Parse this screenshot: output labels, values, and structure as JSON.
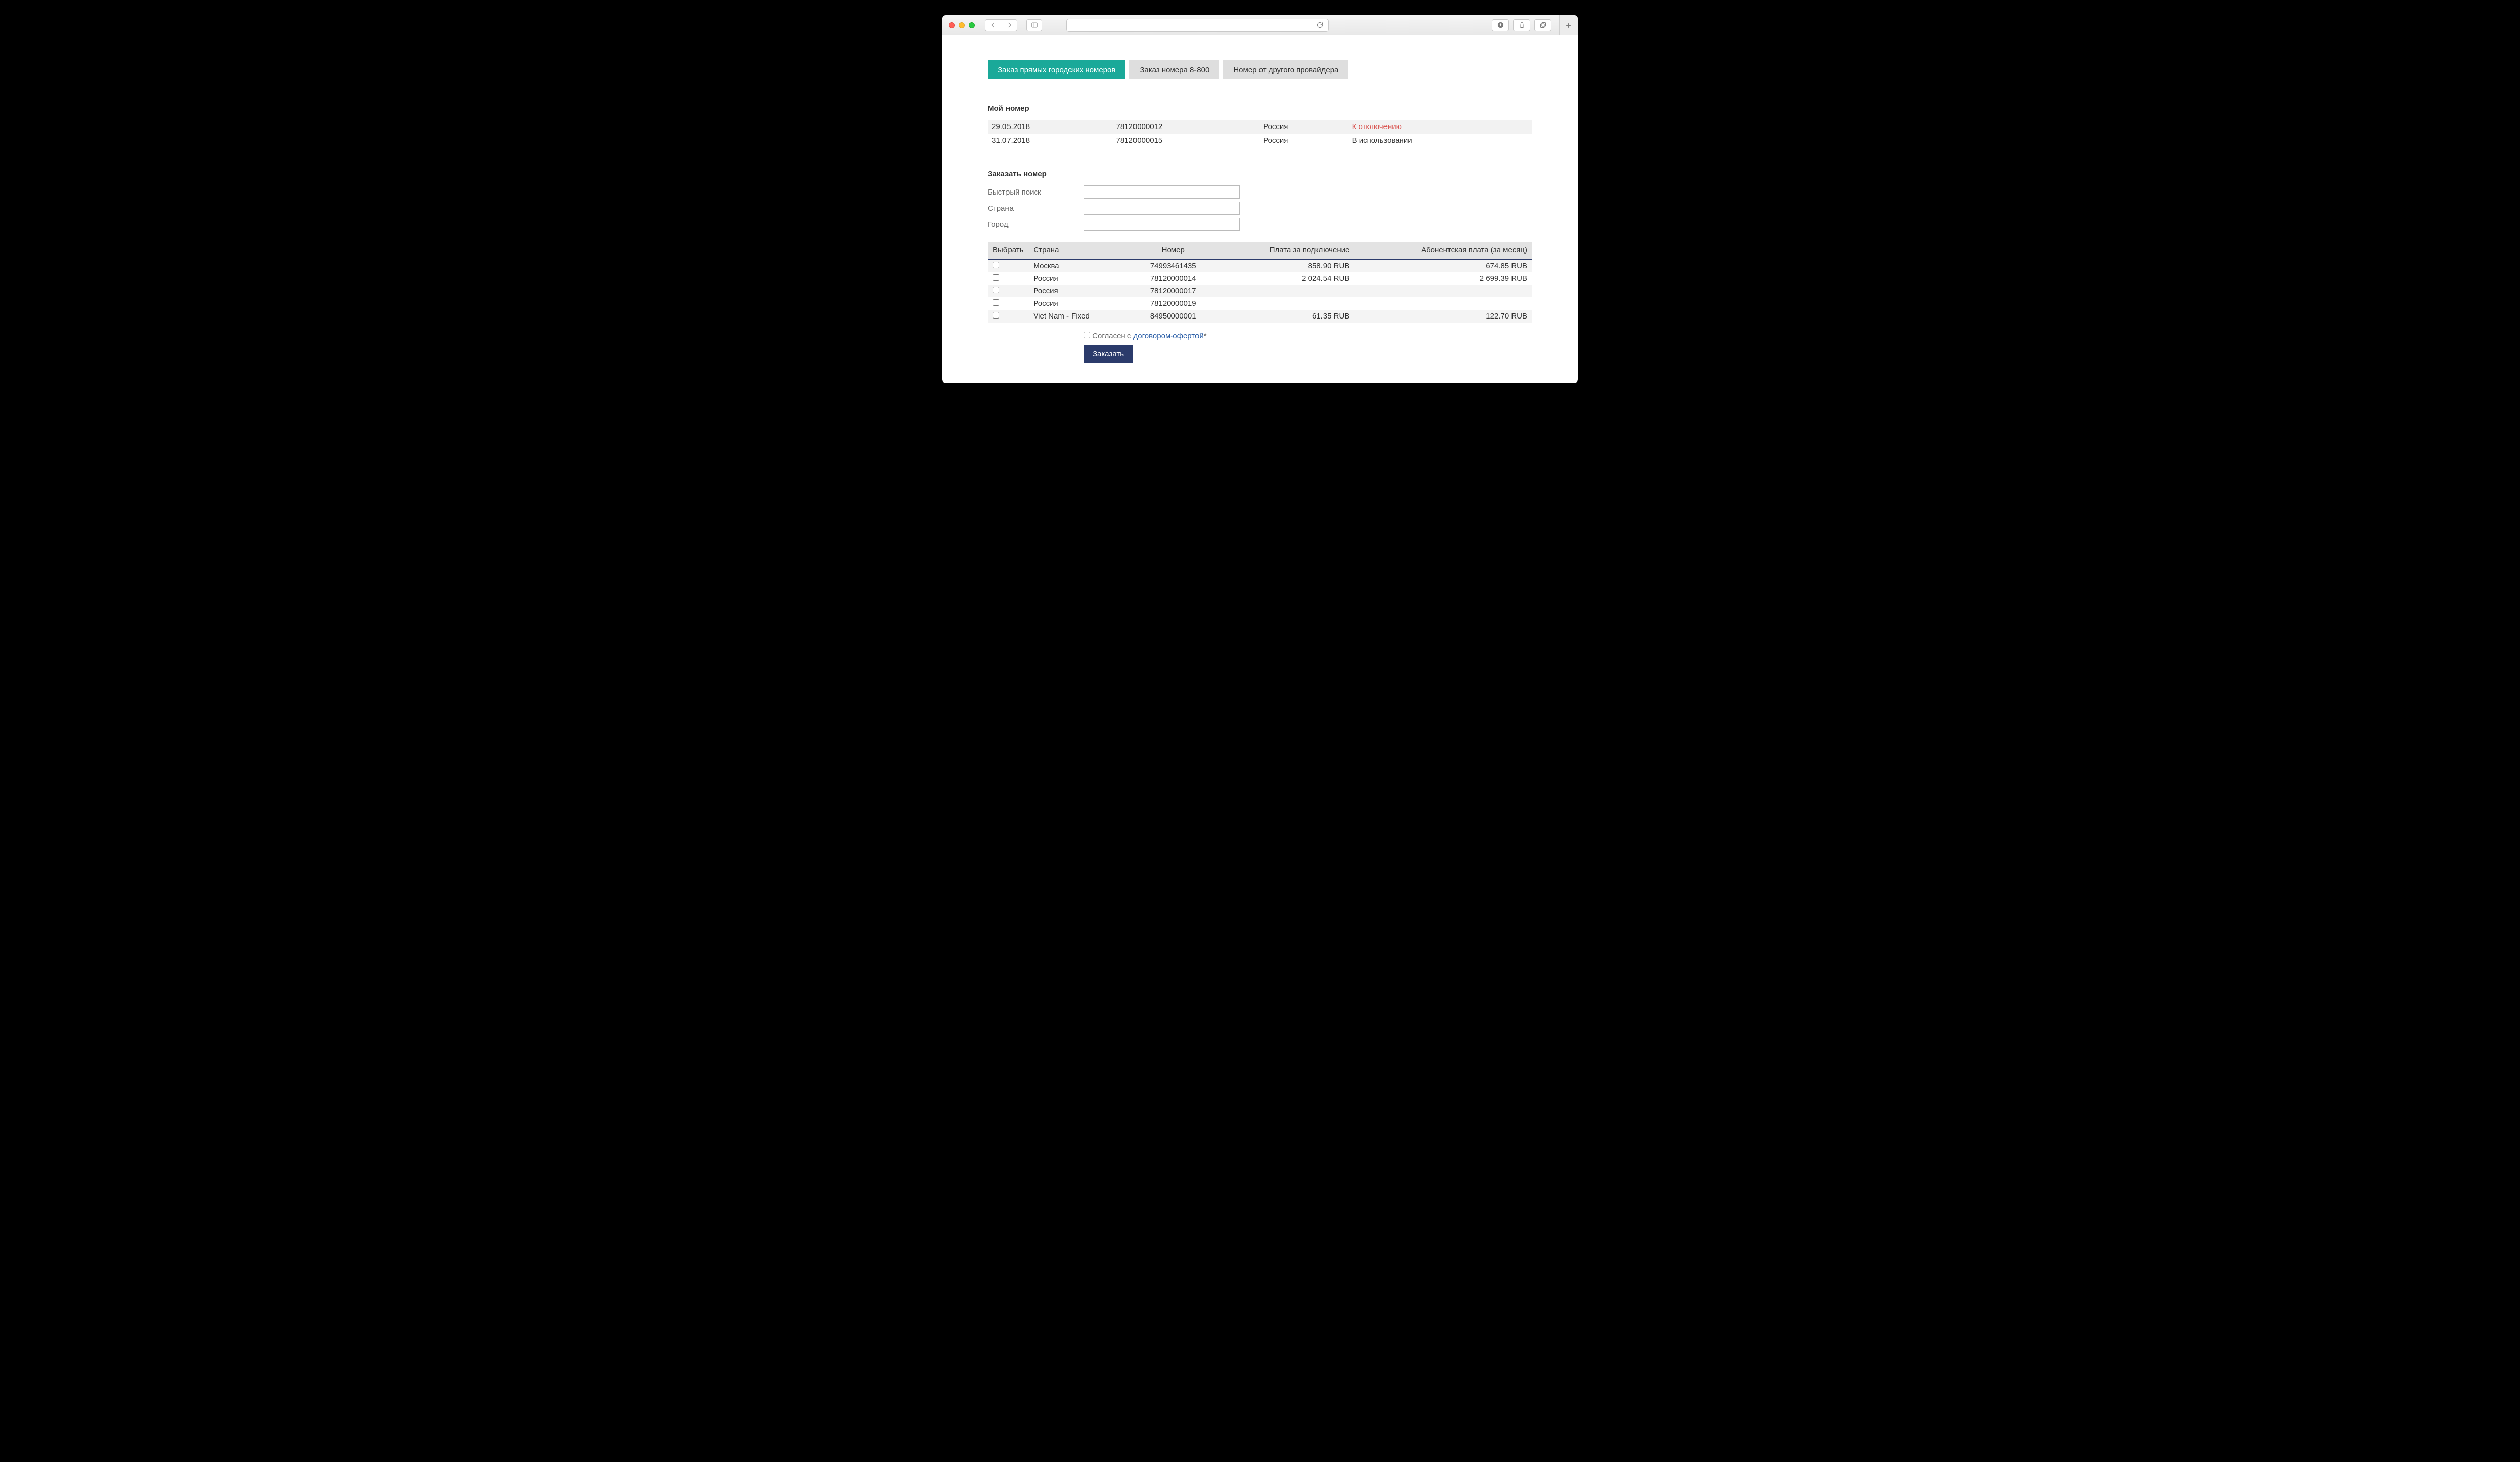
{
  "toolbar": {
    "download_icon": "download",
    "share_icon": "share",
    "tabs_icon": "tabs",
    "newtab_icon": "plus"
  },
  "tabs": {
    "city": "Заказ прямых городских номеров",
    "eight800": "Заказ номера 8-800",
    "other": "Номер от другого провайдера"
  },
  "sections": {
    "my_number": "Мой номер",
    "order_number": "Заказать номер"
  },
  "my_numbers": [
    {
      "date": "29.05.2018",
      "number": "78120000012",
      "country": "Россия",
      "status": "К отключению",
      "status_class": "warn"
    },
    {
      "date": "31.07.2018",
      "number": "78120000015",
      "country": "Россия",
      "status": "В использовании",
      "status_class": ""
    }
  ],
  "filters": {
    "quick_search_label": "Быстрый поиск",
    "country_label": "Страна",
    "city_label": "Город",
    "quick_search_value": "",
    "country_value": "",
    "city_value": ""
  },
  "avail_headers": {
    "select": "Выбрать",
    "country": "Страна",
    "number": "Номер",
    "conn_fee": "Плата за подключение",
    "monthly": "Абонентская плата (за месяц)"
  },
  "avail_rows": [
    {
      "country": "Москва",
      "number": "74993461435",
      "conn": "858.90 RUB",
      "monthly": "674.85 RUB"
    },
    {
      "country": "Россия",
      "number": "78120000014",
      "conn": "2 024.54 RUB",
      "monthly": "2 699.39 RUB"
    },
    {
      "country": "Россия",
      "number": "78120000017",
      "conn": "",
      "monthly": ""
    },
    {
      "country": "Россия",
      "number": "78120000019",
      "conn": "",
      "monthly": ""
    },
    {
      "country": "Viet Nam - Fixed",
      "number": "84950000001",
      "conn": "61.35 RUB",
      "monthly": "122.70 RUB"
    }
  ],
  "agree": {
    "prefix": "Согласен с ",
    "link": "договором-офертой",
    "suffix": "*"
  },
  "order_button": "Заказать"
}
